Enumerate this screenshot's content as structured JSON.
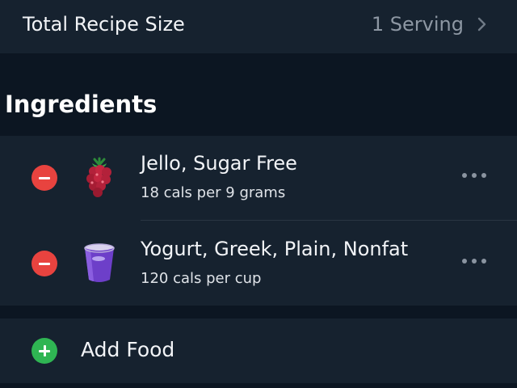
{
  "recipe_size": {
    "label": "Total Recipe Size",
    "value": "1 Serving"
  },
  "ingredients": {
    "title": "Ingredients",
    "items": [
      {
        "name": "Jello, Sugar Free",
        "detail": "18 cals per 9 grams",
        "icon": "raspberry-icon"
      },
      {
        "name": "Yogurt, Greek, Plain, Nonfat",
        "detail": "120 cals per cup",
        "icon": "yogurt-cup-icon"
      }
    ]
  },
  "add_food": {
    "label": "Add Food"
  },
  "colors": {
    "background": "#0c1622",
    "card": "#16222f",
    "remove": "#e8433f",
    "add": "#2fb553",
    "muted_text": "#8d97a3"
  }
}
